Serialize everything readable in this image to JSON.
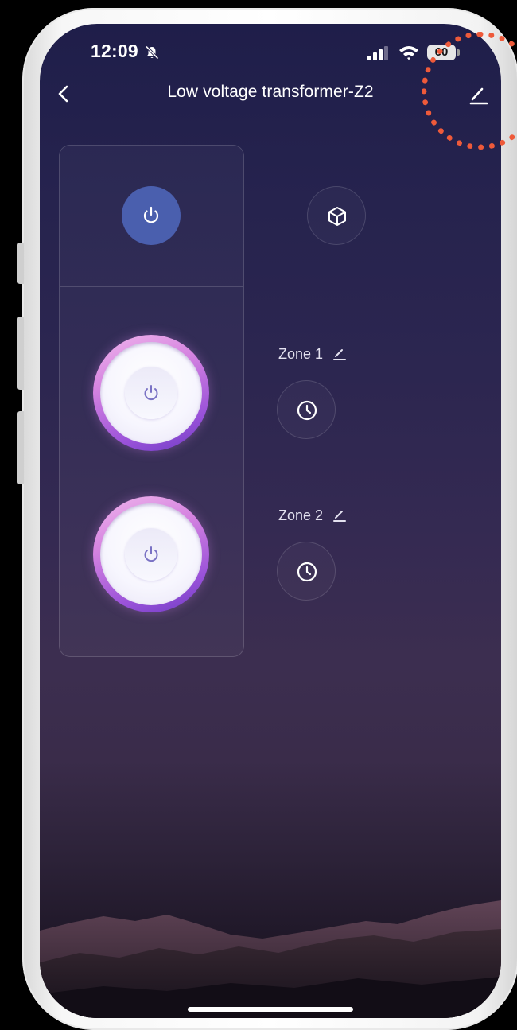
{
  "status_bar": {
    "time": "12:09",
    "battery": "60",
    "bell_icon": "bell-slash-icon",
    "signal_icon": "cellular-signal-icon",
    "wifi_icon": "wifi-icon"
  },
  "header": {
    "title": "Low voltage transformer-Z2",
    "back_icon": "chevron-left-icon",
    "edit_icon": "pencil-icon"
  },
  "master": {
    "power_icon": "power-icon",
    "scene_icon": "cube-icon"
  },
  "zones": [
    {
      "label": "Zone 1",
      "edit_icon": "pencil-icon",
      "timer_icon": "clock-icon"
    },
    {
      "label": "Zone 2",
      "edit_icon": "pencil-icon",
      "timer_icon": "clock-icon"
    }
  ],
  "colors": {
    "master_power": "#4a5fae",
    "zone_ring": "#c77be0",
    "annotation_circle": "#ee5a3a"
  }
}
